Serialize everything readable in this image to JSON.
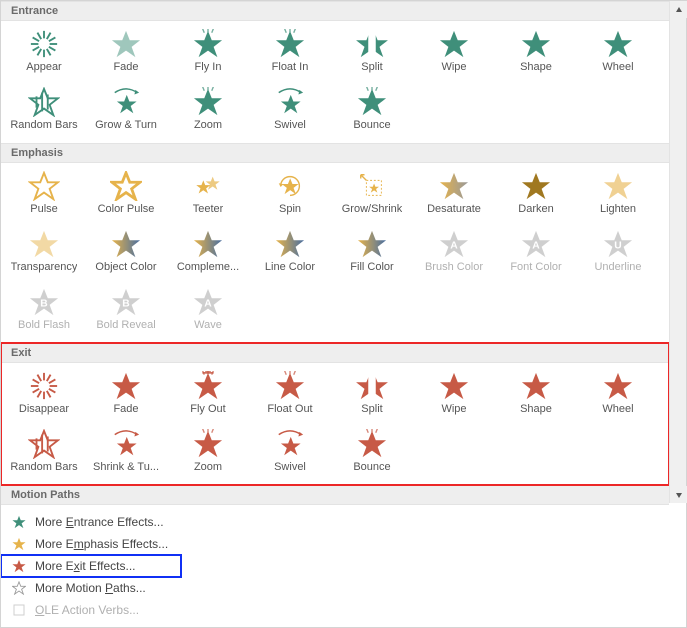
{
  "colors": {
    "entrance": "#3f8f7a",
    "emphasis": "#e6b34b",
    "exit": "#c75a46",
    "motion": "#8aa59b",
    "disabled": "#cfcfcf",
    "highlight_red": "#ec2727",
    "highlight_blue": "#1030f5"
  },
  "sections": [
    {
      "id": "entrance",
      "header": "Entrance",
      "highlight": false,
      "effects": [
        {
          "label": "Appear",
          "icon": "burst"
        },
        {
          "label": "Fade",
          "icon": "star-fade"
        },
        {
          "label": "Fly In",
          "icon": "star-flyin"
        },
        {
          "label": "Float In",
          "icon": "star-float"
        },
        {
          "label": "Split",
          "icon": "star-split"
        },
        {
          "label": "Wipe",
          "icon": "star-wipe"
        },
        {
          "label": "Shape",
          "icon": "star-solid"
        },
        {
          "label": "Wheel",
          "icon": "star-solid"
        },
        {
          "label": "Random Bars",
          "icon": "star-bars"
        },
        {
          "label": "Grow & Turn",
          "icon": "star-grow"
        },
        {
          "label": "Zoom",
          "icon": "star-zoom"
        },
        {
          "label": "Swivel",
          "icon": "star-swivel"
        },
        {
          "label": "Bounce",
          "icon": "star-bounce"
        }
      ]
    },
    {
      "id": "emphasis",
      "header": "Emphasis",
      "highlight": false,
      "effects": [
        {
          "label": "Pulse",
          "icon": "star-outline"
        },
        {
          "label": "Color Pulse",
          "icon": "star-outline-bold"
        },
        {
          "label": "Teeter",
          "icon": "teeter"
        },
        {
          "label": "Spin",
          "icon": "spin"
        },
        {
          "label": "Grow/Shrink",
          "icon": "growshrink"
        },
        {
          "label": "Desaturate",
          "icon": "star-grad"
        },
        {
          "label": "Darken",
          "icon": "star-dark"
        },
        {
          "label": "Lighten",
          "icon": "star-light"
        },
        {
          "label": "Transparency",
          "icon": "star-trans"
        },
        {
          "label": "Object Color",
          "icon": "star-bicolor"
        },
        {
          "label": "Compleme...",
          "icon": "star-bicolor"
        },
        {
          "label": "Line Color",
          "icon": "star-bicolor"
        },
        {
          "label": "Fill Color",
          "icon": "star-bicolor"
        },
        {
          "label": "Brush Color",
          "icon": "star-letter",
          "letter": "A",
          "disabled": true
        },
        {
          "label": "Font Color",
          "icon": "star-letter",
          "letter": "A",
          "disabled": true
        },
        {
          "label": "Underline",
          "icon": "star-letter",
          "letter": "U",
          "disabled": true
        },
        {
          "label": "Bold Flash",
          "icon": "star-letter",
          "letter": "B",
          "disabled": true
        },
        {
          "label": "Bold Reveal",
          "icon": "star-letter",
          "letter": "B",
          "disabled": true
        },
        {
          "label": "Wave",
          "icon": "star-letter",
          "letter": "A",
          "disabled": true
        }
      ]
    },
    {
      "id": "exit",
      "header": "Exit",
      "highlight": true,
      "effects": [
        {
          "label": "Disappear",
          "icon": "burst"
        },
        {
          "label": "Fade",
          "icon": "star-solid"
        },
        {
          "label": "Fly Out",
          "icon": "star-flyout"
        },
        {
          "label": "Float Out",
          "icon": "star-float"
        },
        {
          "label": "Split",
          "icon": "star-split"
        },
        {
          "label": "Wipe",
          "icon": "star-wipe"
        },
        {
          "label": "Shape",
          "icon": "star-solid"
        },
        {
          "label": "Wheel",
          "icon": "star-solid"
        },
        {
          "label": "Random Bars",
          "icon": "star-bars"
        },
        {
          "label": "Shrink & Tu...",
          "icon": "star-grow"
        },
        {
          "label": "Zoom",
          "icon": "star-zoom"
        },
        {
          "label": "Swivel",
          "icon": "star-swivel"
        },
        {
          "label": "Bounce",
          "icon": "star-bounce"
        }
      ]
    },
    {
      "id": "motion",
      "header": "Motion Paths",
      "highlight": false,
      "effects": [
        {
          "label": "",
          "icon": "path-line"
        },
        {
          "label": "",
          "icon": "path-arc"
        },
        {
          "label": "",
          "icon": "path-turn"
        },
        {
          "label": "",
          "icon": "path-circle"
        },
        {
          "label": "",
          "icon": "path-loop"
        },
        {
          "label": "",
          "icon": "path-zigzag"
        }
      ]
    }
  ],
  "footer_items": [
    {
      "label_pre": "More ",
      "mn": "E",
      "label_post": "ntrance Effects...",
      "icon": "star-mini",
      "color": "#3f8f7a"
    },
    {
      "label_pre": "More E",
      "mn": "m",
      "label_post": "phasis Effects...",
      "icon": "star-mini",
      "color": "#e6b34b"
    },
    {
      "label_pre": "More E",
      "mn": "x",
      "label_post": "it Effects...",
      "icon": "star-mini",
      "color": "#c75a46",
      "highlight": true
    },
    {
      "label_pre": "More Motion ",
      "mn": "P",
      "label_post": "aths...",
      "icon": "star-mini-outline",
      "color": "#999"
    },
    {
      "label_pre": "",
      "mn": "O",
      "label_post": "LE Action Verbs...",
      "icon": "ole",
      "color": "#ccc",
      "disabled": true
    }
  ]
}
